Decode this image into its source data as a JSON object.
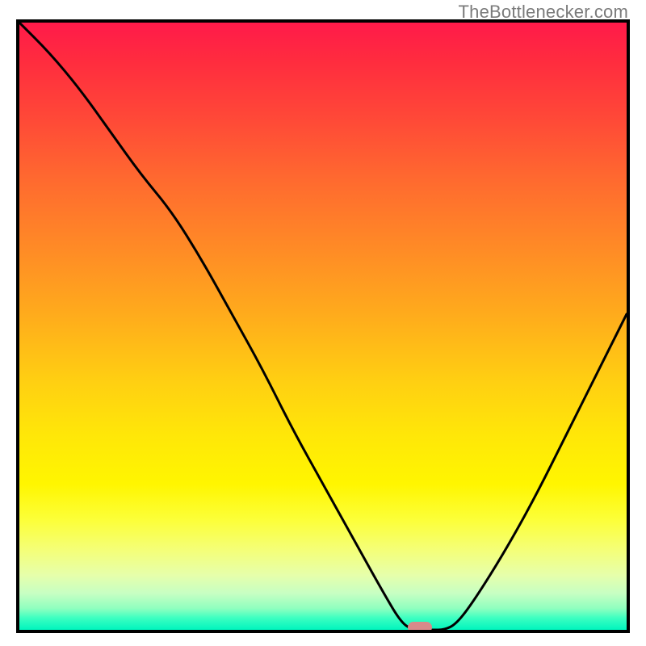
{
  "watermark": "TheBottlenecker.com",
  "colors": {
    "border": "#000000",
    "curve": "#000000",
    "marker": "#d88a8a",
    "gradient_top": "#ff1a4a",
    "gradient_bottom": "#00f5be"
  },
  "chart_data": {
    "type": "line",
    "title": "",
    "xlabel": "",
    "ylabel": "",
    "xlim": [
      0,
      100
    ],
    "ylim": [
      0,
      100
    ],
    "grid": false,
    "series": [
      {
        "name": "bottleneck-curve",
        "x": [
          0,
          5,
          10,
          15,
          20,
          25,
          30,
          35,
          40,
          45,
          50,
          55,
          60,
          63,
          65,
          68,
          70,
          72,
          75,
          80,
          85,
          90,
          95,
          100
        ],
        "values": [
          100,
          95,
          89,
          82,
          75,
          69,
          61,
          52,
          43,
          33,
          24,
          15,
          6,
          1,
          0,
          0,
          0,
          1,
          5,
          13,
          22,
          32,
          42,
          52
        ]
      }
    ],
    "marker": {
      "name": "optimum-point",
      "x": 66,
      "y": 0
    },
    "annotations": [
      {
        "text": "TheBottlenecker.com",
        "position": "top-right"
      }
    ]
  }
}
